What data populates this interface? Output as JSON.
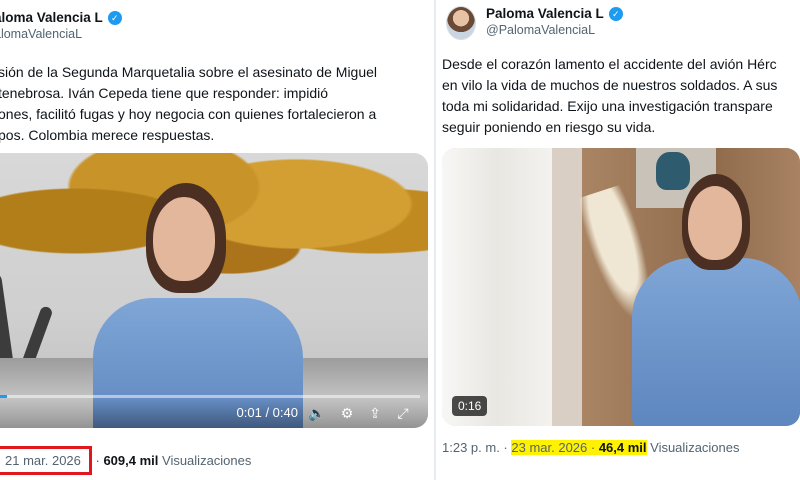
{
  "left_post": {
    "author_name": "aloma Valencia L",
    "handle": "alomaValenciaL",
    "text_lines": [
      "sión de la Segunda Marquetalia sobre el asesinato de Miguel",
      "tenebrosa. Iván Cepeda tiene que responder: impidió",
      "ones, facilitó fugas y hoy negocia con quienes fortalecieron a",
      "pos. Colombia merece respuestas."
    ],
    "video": {
      "time_label": "0:01 / 0:40",
      "progress": 0.025,
      "icons": [
        "volume-icon",
        "settings-icon",
        "share-icon",
        "fullscreen-icon"
      ]
    },
    "meta": {
      "date": "21 mar. 2026",
      "separator": " · ",
      "views_count": "609,4 mil",
      "views_label": " Visualizaciones"
    }
  },
  "right_post": {
    "author_name": "Paloma Valencia L",
    "handle": "@PalomaValenciaL",
    "text_lines": [
      "Desde el corazón lamento el accidente del avión Hérc",
      "en vilo la vida de muchos de nuestros soldados. A sus",
      "toda mi solidaridad. Exijo una investigación transpare",
      "seguir poniendo en riesgo su vida."
    ],
    "video": {
      "duration": "0:16"
    },
    "meta": {
      "time": "1:23 p. m. · ",
      "date_highlighted": "23 mar. 2026 ·",
      "views_count": " 46,4 mil",
      "views_label": " Visualizaciones"
    }
  },
  "colors": {
    "verified": "#1d9bf0",
    "date_box": "#e0181e",
    "highlight": "#fff200",
    "secondary_text": "#536471"
  }
}
